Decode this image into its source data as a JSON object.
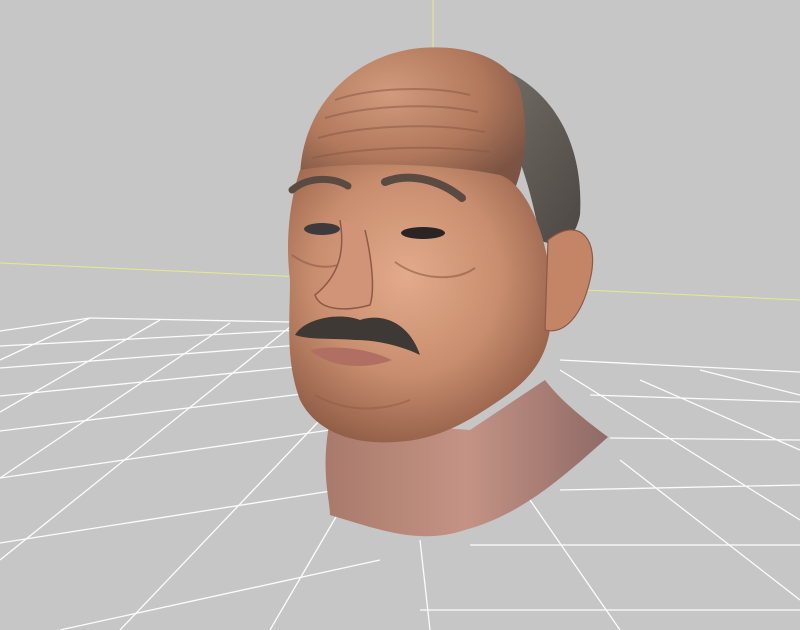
{
  "viewport": {
    "background_color": "#c6c6c6",
    "grid_line_color": "#ffffff",
    "axis_x_color": "#e6e98a",
    "axis_y_color": "#e6e98a",
    "model": {
      "type": "3d-head-mesh",
      "skin_color": "#c88d6e",
      "hair_color": "#6b6660",
      "mustache_color": "#3f3935"
    }
  }
}
